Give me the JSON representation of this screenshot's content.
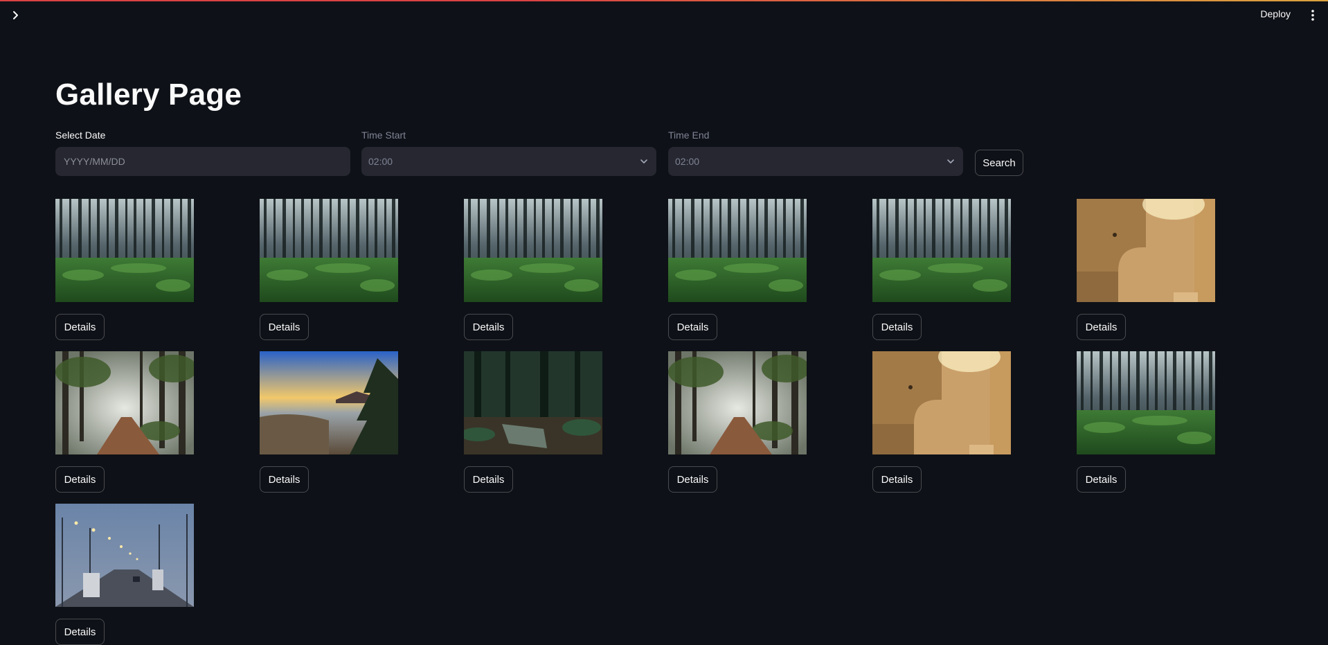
{
  "header": {
    "deploy_label": "Deploy",
    "expand_icon": "chevron-right-icon",
    "menu_icon": "kebab-menu-icon"
  },
  "page": {
    "title": "Gallery Page"
  },
  "filters": {
    "date": {
      "label": "Select Date",
      "placeholder": "YYYY/MM/DD",
      "value": ""
    },
    "time_start": {
      "label": "Time Start",
      "value": "02:00"
    },
    "time_end": {
      "label": "Time End",
      "value": "02:00"
    },
    "search_label": "Search"
  },
  "gallery": {
    "items": [
      {
        "scene": "pine-forest",
        "details_label": "Details"
      },
      {
        "scene": "pine-forest",
        "details_label": "Details"
      },
      {
        "scene": "pine-forest",
        "details_label": "Details"
      },
      {
        "scene": "pine-forest",
        "details_label": "Details"
      },
      {
        "scene": "pine-forest",
        "details_label": "Details"
      },
      {
        "scene": "beige-room",
        "details_label": "Details"
      },
      {
        "scene": "misty-forest-path",
        "details_label": "Details"
      },
      {
        "scene": "sunset-pine",
        "details_label": "Details"
      },
      {
        "scene": "dark-forest-bench",
        "details_label": "Details"
      },
      {
        "scene": "misty-forest-path",
        "details_label": "Details"
      },
      {
        "scene": "beige-room",
        "details_label": "Details"
      },
      {
        "scene": "pine-forest",
        "details_label": "Details"
      },
      {
        "scene": "highway-dusk",
        "details_label": "Details"
      }
    ]
  },
  "colors": {
    "background": "#0e1117",
    "input_bg": "#262730",
    "text": "#fafafa",
    "muted": "#808495",
    "accent": "#ff4b4b"
  }
}
